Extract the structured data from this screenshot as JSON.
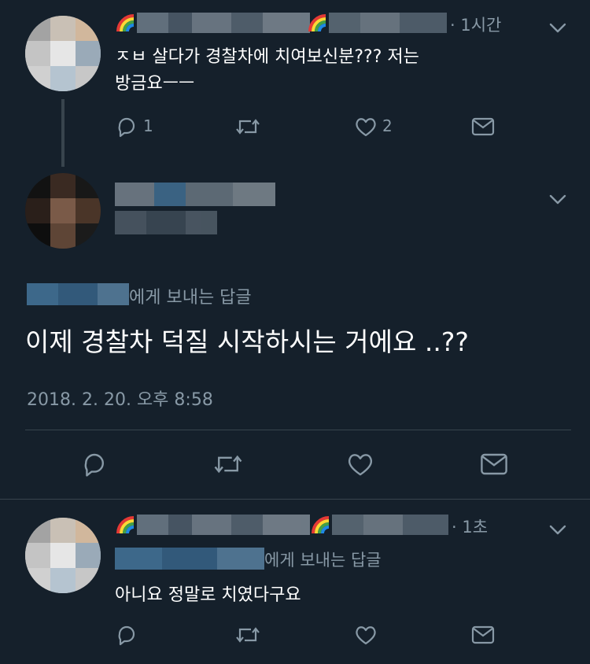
{
  "tweets": {
    "first": {
      "time": "· 1시간",
      "text_line1": "ㅈㅂ 살다가 경찰차에 치여보신분??? 저는",
      "text_line2": "방금요ㅡㅡ",
      "reply_count": "1",
      "like_count": "2"
    },
    "main": {
      "reply_to_suffix": "에게 보내는 답글",
      "text": "이제 경찰차 덕질 시작하시는 거에요 ..??",
      "timestamp": "2018. 2. 20. 오후 8:58"
    },
    "reply": {
      "time": "· 1초",
      "reply_to_suffix": "에게 보내는 답글",
      "text": "아니요 정말로 치였다구요"
    }
  },
  "icons": {
    "reply": "reply-icon",
    "retweet": "retweet-icon",
    "like": "like-icon",
    "dm": "message-icon",
    "more": "chevron-down-icon"
  },
  "colors": {
    "background": "#15202b",
    "secondary_text": "#8899a6",
    "divider": "#38444d"
  }
}
